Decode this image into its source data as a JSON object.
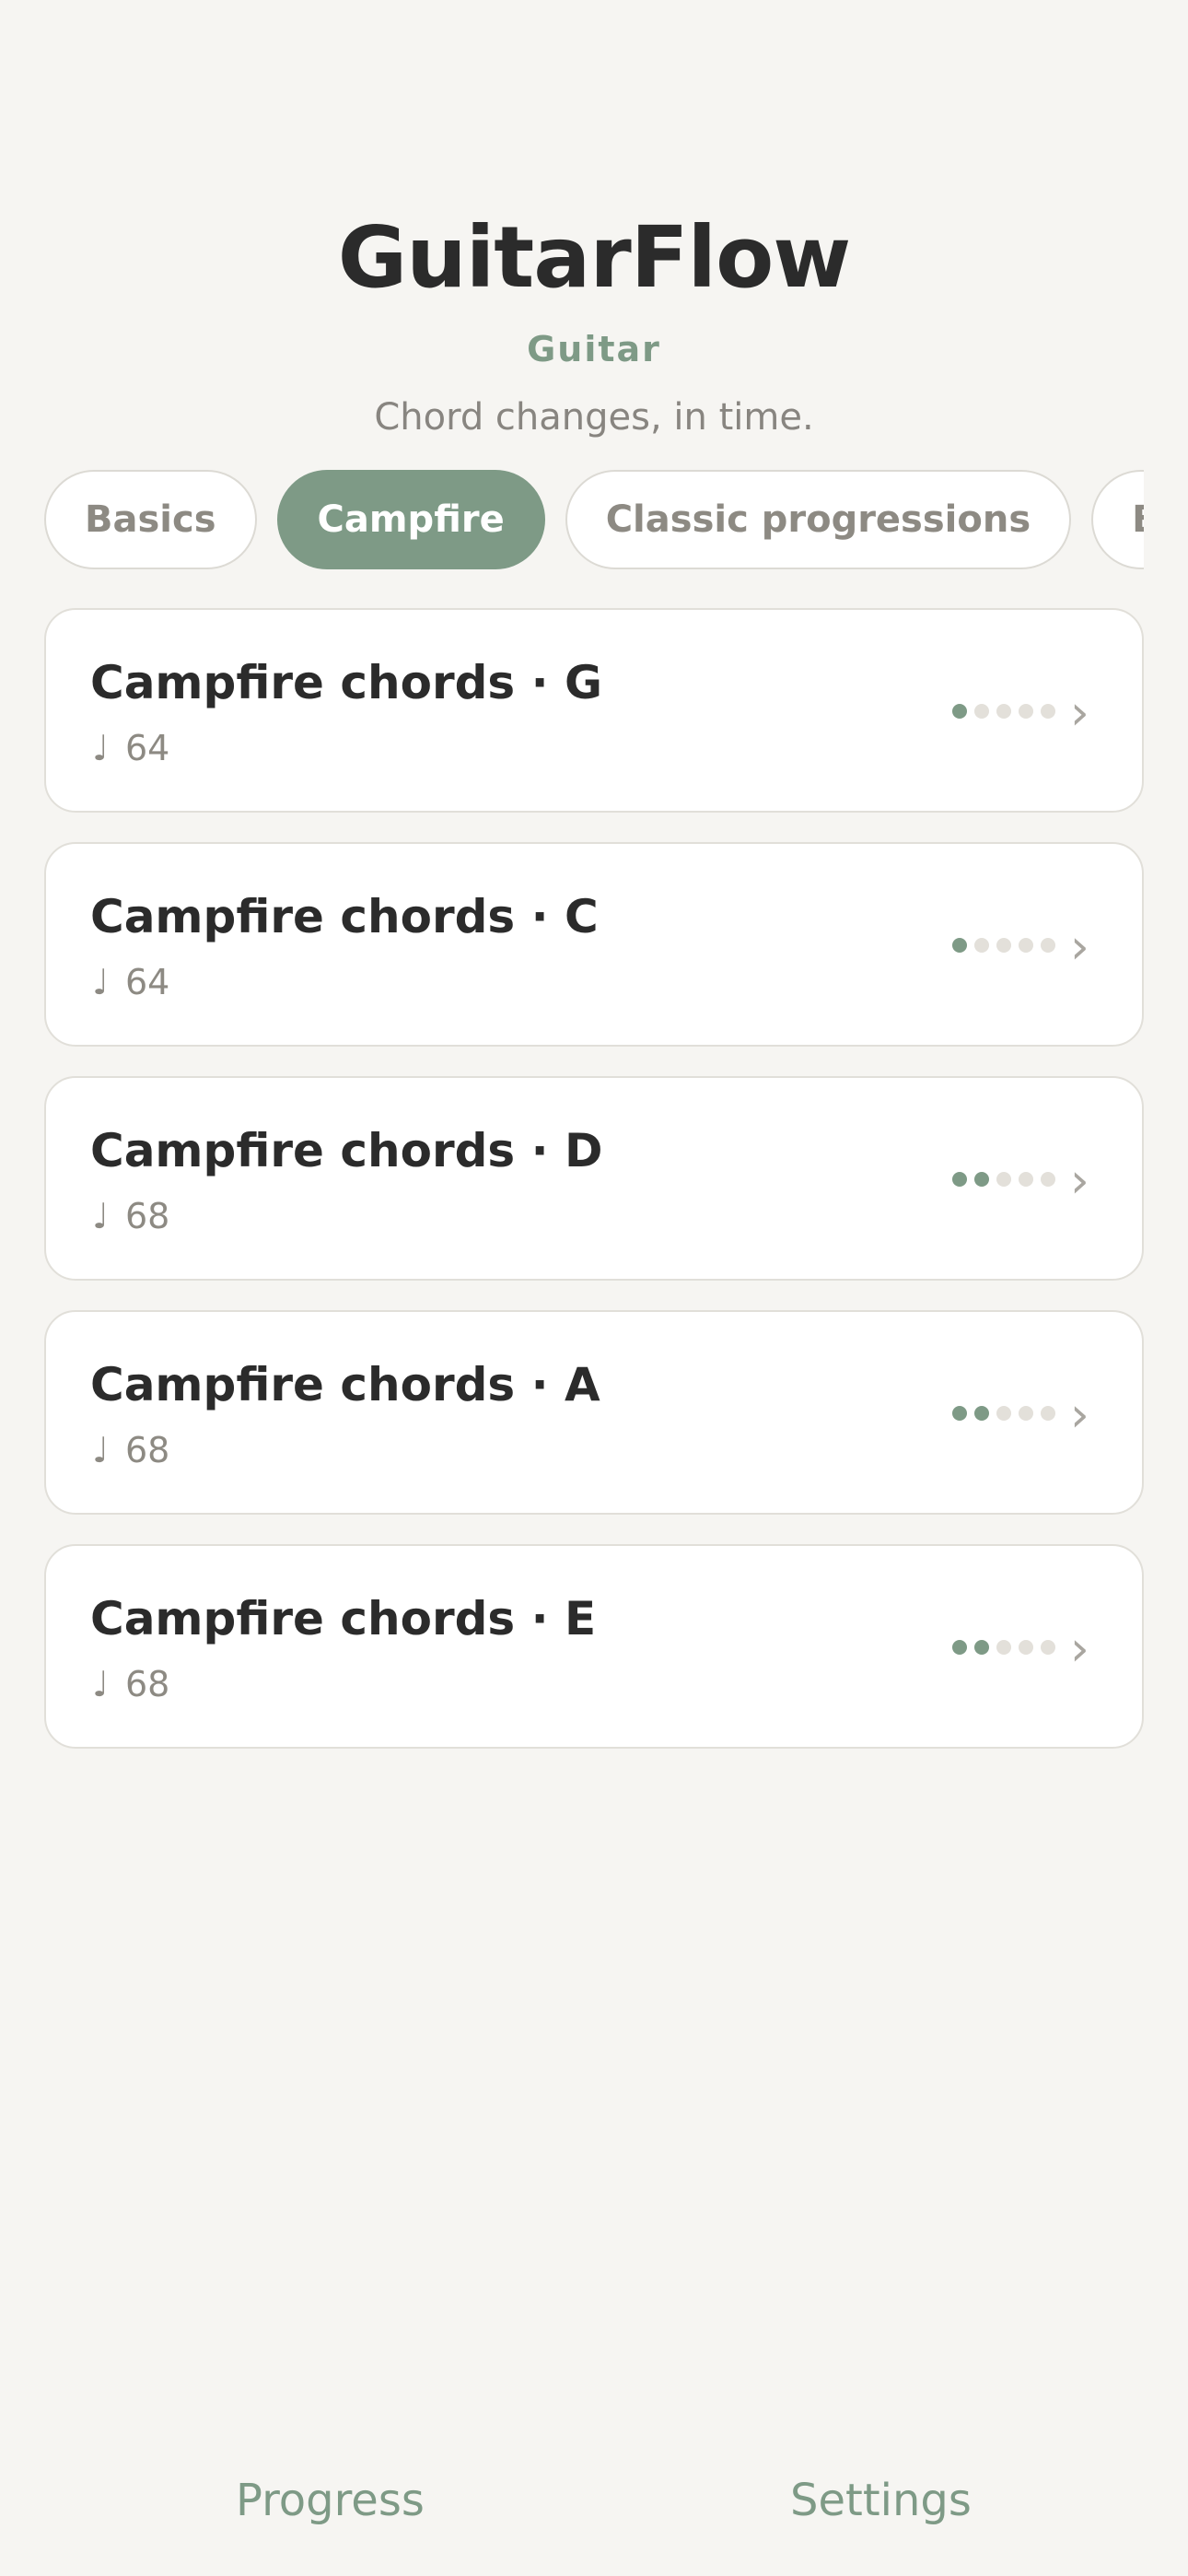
{
  "header": {
    "title": "GuitarFlow",
    "subtitle": "Guitar",
    "tagline": "Chord changes, in time."
  },
  "tabs": [
    {
      "label": "Basics",
      "active": false
    },
    {
      "label": "Campfire",
      "active": true
    },
    {
      "label": "Classic progressions",
      "active": false
    },
    {
      "label": "Blues",
      "active": false
    }
  ],
  "lessons": [
    {
      "title": "Campfire chords · G",
      "tempo": "64",
      "level": 1,
      "level_max": 5
    },
    {
      "title": "Campfire chords · C",
      "tempo": "64",
      "level": 1,
      "level_max": 5
    },
    {
      "title": "Campfire chords · D",
      "tempo": "68",
      "level": 2,
      "level_max": 5
    },
    {
      "title": "Campfire chords · A",
      "tempo": "68",
      "level": 2,
      "level_max": 5
    },
    {
      "title": "Campfire chords · E",
      "tempo": "68",
      "level": 2,
      "level_max": 5
    }
  ],
  "icons": {
    "tempo": "music-note-icon",
    "open": "chevron-right-icon"
  },
  "nav": {
    "progress": "Progress",
    "settings": "Settings"
  },
  "colors": {
    "accent": "#7e9a86",
    "background": "#f6f5f2",
    "dot_inactive": "#e3e0da"
  }
}
